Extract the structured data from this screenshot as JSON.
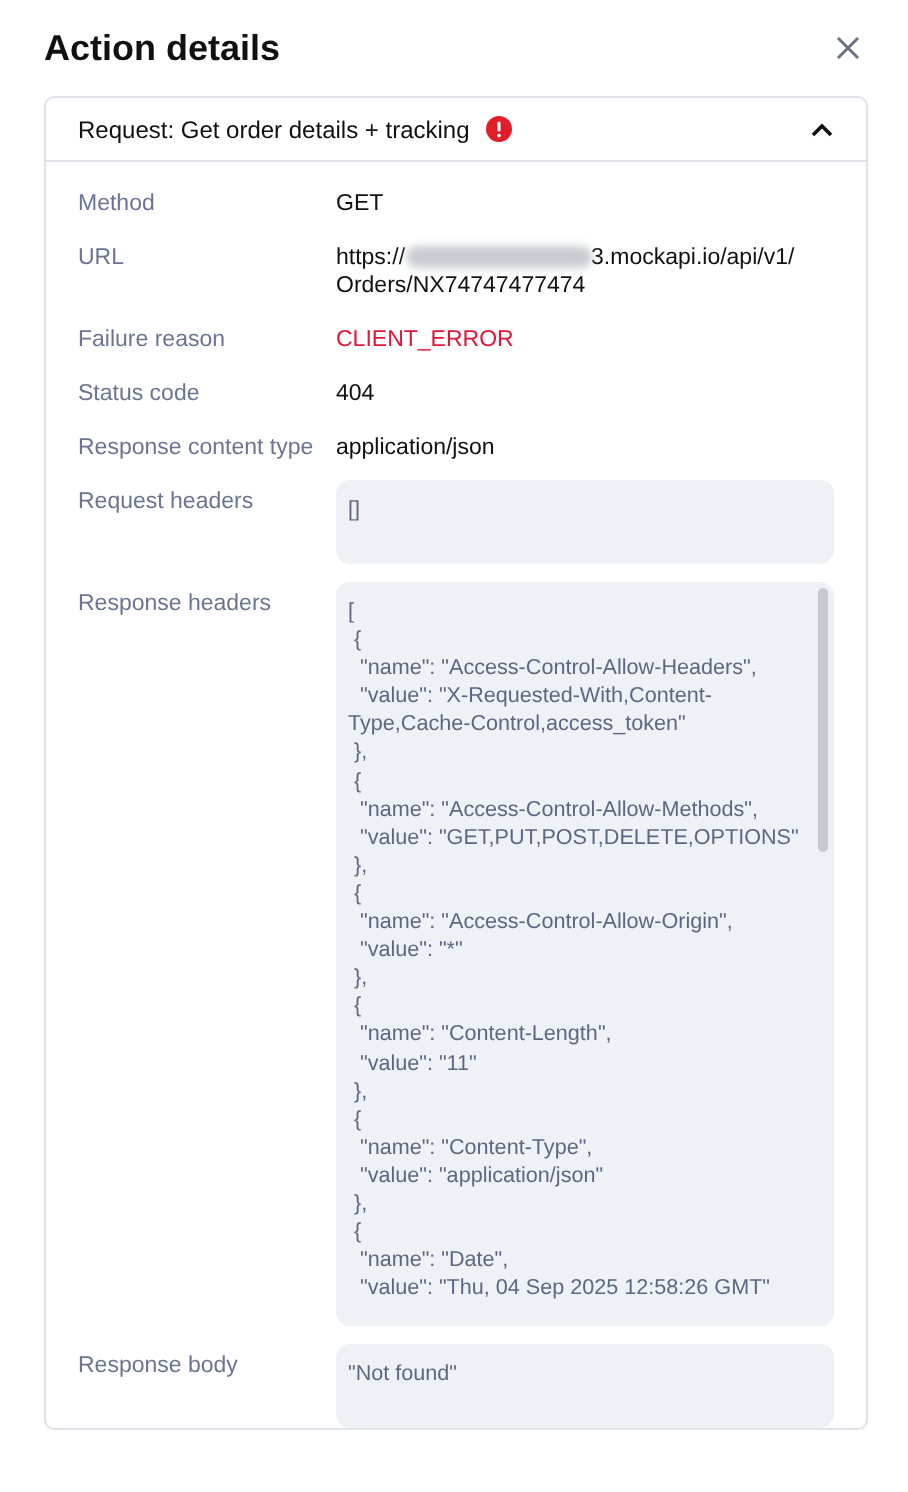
{
  "panel": {
    "title": "Action details"
  },
  "request": {
    "title": "Request: Get order details + tracking",
    "has_error": true,
    "expanded": true,
    "fields": [
      {
        "label": "Method",
        "kind": "text",
        "value": "GET"
      },
      {
        "label": "URL",
        "kind": "redacted",
        "prefix": "https://",
        "suffix": "3.mockapi.io/api/v1/Orders/NX74747477474"
      },
      {
        "label": "Failure reason",
        "kind": "error",
        "value": "CLIENT_ERROR"
      },
      {
        "label": "Status code",
        "kind": "text",
        "value": "404"
      },
      {
        "label": "Response content type",
        "kind": "text",
        "value": "application/json"
      },
      {
        "label": "Request headers",
        "kind": "code",
        "value": "[]"
      },
      {
        "label": "Response headers",
        "kind": "scroll_code",
        "value": "[\n {\n  \"name\": \"Access-Control-Allow-Headers\",\n  \"value\": \"X-Requested-With,Content-Type,Cache-Control,access_token\"\n },\n {\n  \"name\": \"Access-Control-Allow-Methods\",\n  \"value\": \"GET,PUT,POST,DELETE,OPTIONS\"\n },\n {\n  \"name\": \"Access-Control-Allow-Origin\",\n  \"value\": \"*\"\n },\n {\n  \"name\": \"Content-Length\",\n  \"value\": \"11\"\n },\n {\n  \"name\": \"Content-Type\",\n  \"value\": \"application/json\"\n },\n {\n  \"name\": \"Date\",\n  \"value\": \"Thu, 04 Sep 2025 12:58:26 GMT\""
      },
      {
        "label": "Response body",
        "kind": "code",
        "value": "\"Not found\""
      }
    ]
  }
}
